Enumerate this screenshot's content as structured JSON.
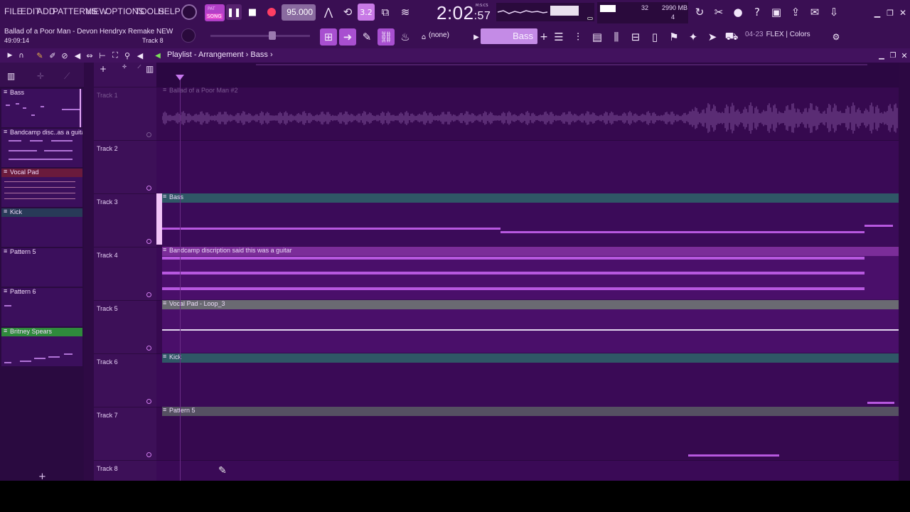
{
  "menu": [
    "FILE",
    "EDIT",
    "ADD",
    "PATTERNS",
    "VIEW",
    "OPTIONS",
    "TOOLS",
    "HELP"
  ],
  "song": {
    "title": "Ballad of a Poor Man - Devon Hendryx Remake NEW",
    "time": "49:09:14",
    "track_hint": "Track 8"
  },
  "transport": {
    "pat_label": "PAT",
    "song_label": "SONG",
    "tempo": "95.000",
    "clock_main": "2:02",
    "clock_sub": ":57",
    "clock_unit": "M:S:CS",
    "snap_value": "3.2"
  },
  "monitor": {
    "polyphony": "32",
    "memory": "2990 MB",
    "memory_sub": "4"
  },
  "toolbar2": {
    "pattern_selector": "(none)",
    "channel_selector": "Bass",
    "hint_time": "04-23",
    "hint_text": "FLEX | Colors"
  },
  "playlist": {
    "title": "Playlist - Arrangement",
    "pattern": "Bass",
    "separator": "›"
  },
  "picker": {
    "items": [
      {
        "label": "Bass",
        "color": "#3b0f5c"
      },
      {
        "label": "Bandcamp disc..as a guitar",
        "color": "#3b0f5c"
      },
      {
        "label": "Vocal Pad",
        "color": "#6a1a3c"
      },
      {
        "label": "Kick",
        "color": "#283a58"
      },
      {
        "label": "Pattern 5",
        "color": "#3b0f5c"
      },
      {
        "label": "Pattern 6",
        "color": "#3b0f5c"
      },
      {
        "label": "Britney Spears",
        "color": "#2f8a3c"
      }
    ]
  },
  "tracks": [
    {
      "name": "Track 1",
      "clip": "Ballad of a Poor Man #2",
      "clip_color": "#4a1366"
    },
    {
      "name": "Track 2",
      "clip": "",
      "clip_color": ""
    },
    {
      "name": "Track 3",
      "clip": "Bass",
      "clip_color": "#2f5766"
    },
    {
      "name": "Track 4",
      "clip": "Bandcamp discription said this was a guitar",
      "clip_color": "#7b2d99"
    },
    {
      "name": "Track 5",
      "clip": "Vocal Pad - Loop_3",
      "clip_color": "#6a6a72"
    },
    {
      "name": "Track 6",
      "clip": "Kick",
      "clip_color": "#2f5766"
    },
    {
      "name": "Track 7",
      "clip": "Pattern 5",
      "clip_color": "#555062"
    },
    {
      "name": "Track 8",
      "clip": "",
      "clip_color": ""
    }
  ],
  "icons": {
    "tempo_tap": "metronome-icon",
    "wait": "wait-icon",
    "typing": "typing-keyboard-icon",
    "countdown": "countdown-icon",
    "undo": "undo-icon",
    "cut": "cut-icon",
    "mic": "microphone-icon",
    "help": "help-icon",
    "save": "save-icon",
    "export": "export-icon",
    "chat": "chat-icon",
    "download": "download-icon"
  },
  "colors": {
    "accent": "#c87ae6",
    "record": "#ff3e63",
    "bg": "#36094f"
  }
}
